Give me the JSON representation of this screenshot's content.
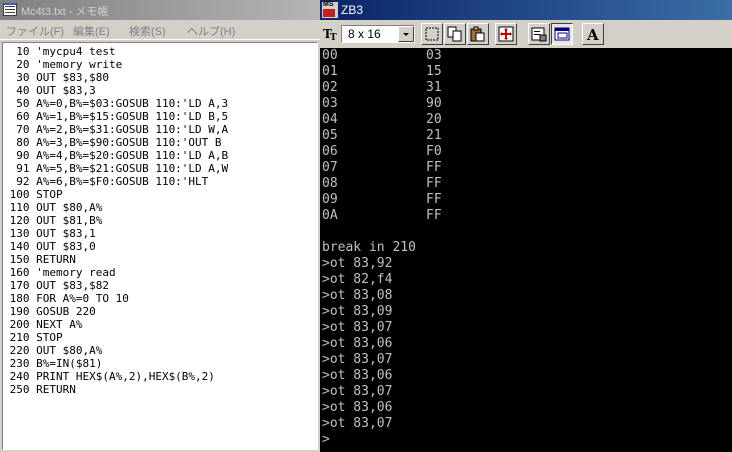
{
  "notepad": {
    "title": "Mc4t3.txt - メモ帳",
    "menu": [
      "ファイル(F)",
      "編集(E)",
      "検索(S)",
      "ヘルプ(H)"
    ],
    "lines": [
      "  10 'mycpu4 test",
      "  20 'memory write",
      "  30 OUT $83,$80",
      "  40 OUT $83,3",
      "  50 A%=0,B%=$03:GOSUB 110:'LD A,3",
      "  60 A%=1,B%=$15:GOSUB 110:'LD B,5",
      "  70 A%=2,B%=$31:GOSUB 110:'LD W,A",
      "  80 A%=3,B%=$90:GOSUB 110:'OUT B",
      "  90 A%=4,B%=$20:GOSUB 110:'LD A,B",
      "  91 A%=5,B%=$21:GOSUB 110:'LD A,W",
      "  92 A%=6,B%=$F0:GOSUB 110:'HLT",
      " 100 STOP",
      " 110 OUT $80,A%",
      " 120 OUT $81,B%",
      " 130 OUT $83,1",
      " 140 OUT $83,0",
      " 150 RETURN",
      " 160 'memory read",
      " 170 OUT $83,$82",
      " 180 FOR A%=0 TO 10",
      " 190 GOSUB 220",
      " 200 NEXT A%",
      " 210 STOP",
      " 220 OUT $80,A%",
      " 230 B%=IN($81)",
      " 240 PRINT HEX$(A%,2),HEX$(B%,2)",
      " 250 RETURN"
    ]
  },
  "console": {
    "title": "ZB3",
    "icon_label": "MS",
    "font_size_value": "8 x 16",
    "toolbar_icons": [
      "mark-icon",
      "copy-icon",
      "paste-icon",
      "fullscreen-icon",
      "properties-icon",
      "background-icon",
      "font-icon"
    ],
    "memory_dump": [
      {
        "addr": "00",
        "val": "03"
      },
      {
        "addr": "01",
        "val": "15"
      },
      {
        "addr": "02",
        "val": "31"
      },
      {
        "addr": "03",
        "val": "90"
      },
      {
        "addr": "04",
        "val": "20"
      },
      {
        "addr": "05",
        "val": "21"
      },
      {
        "addr": "06",
        "val": "F0"
      },
      {
        "addr": "07",
        "val": "FF"
      },
      {
        "addr": "08",
        "val": "FF"
      },
      {
        "addr": "09",
        "val": "FF"
      },
      {
        "addr": "0A",
        "val": "FF"
      }
    ],
    "output_lines": [
      "",
      "break in 210",
      ">ot 83,92",
      ">ot 82,f4",
      ">ot 83,08",
      ">ot 83,09",
      ">ot 83,07",
      ">ot 83,06",
      ">ot 83,07",
      ">ot 83,06",
      ">ot 83,07",
      ">ot 83,06",
      ">ot 83,07",
      ">"
    ]
  },
  "colors": {
    "active_title": "#0a246a",
    "inactive_title": "#808080",
    "console_bg": "#000000",
    "console_text": "#c0c0c0",
    "window_face": "#d4d0c8"
  }
}
